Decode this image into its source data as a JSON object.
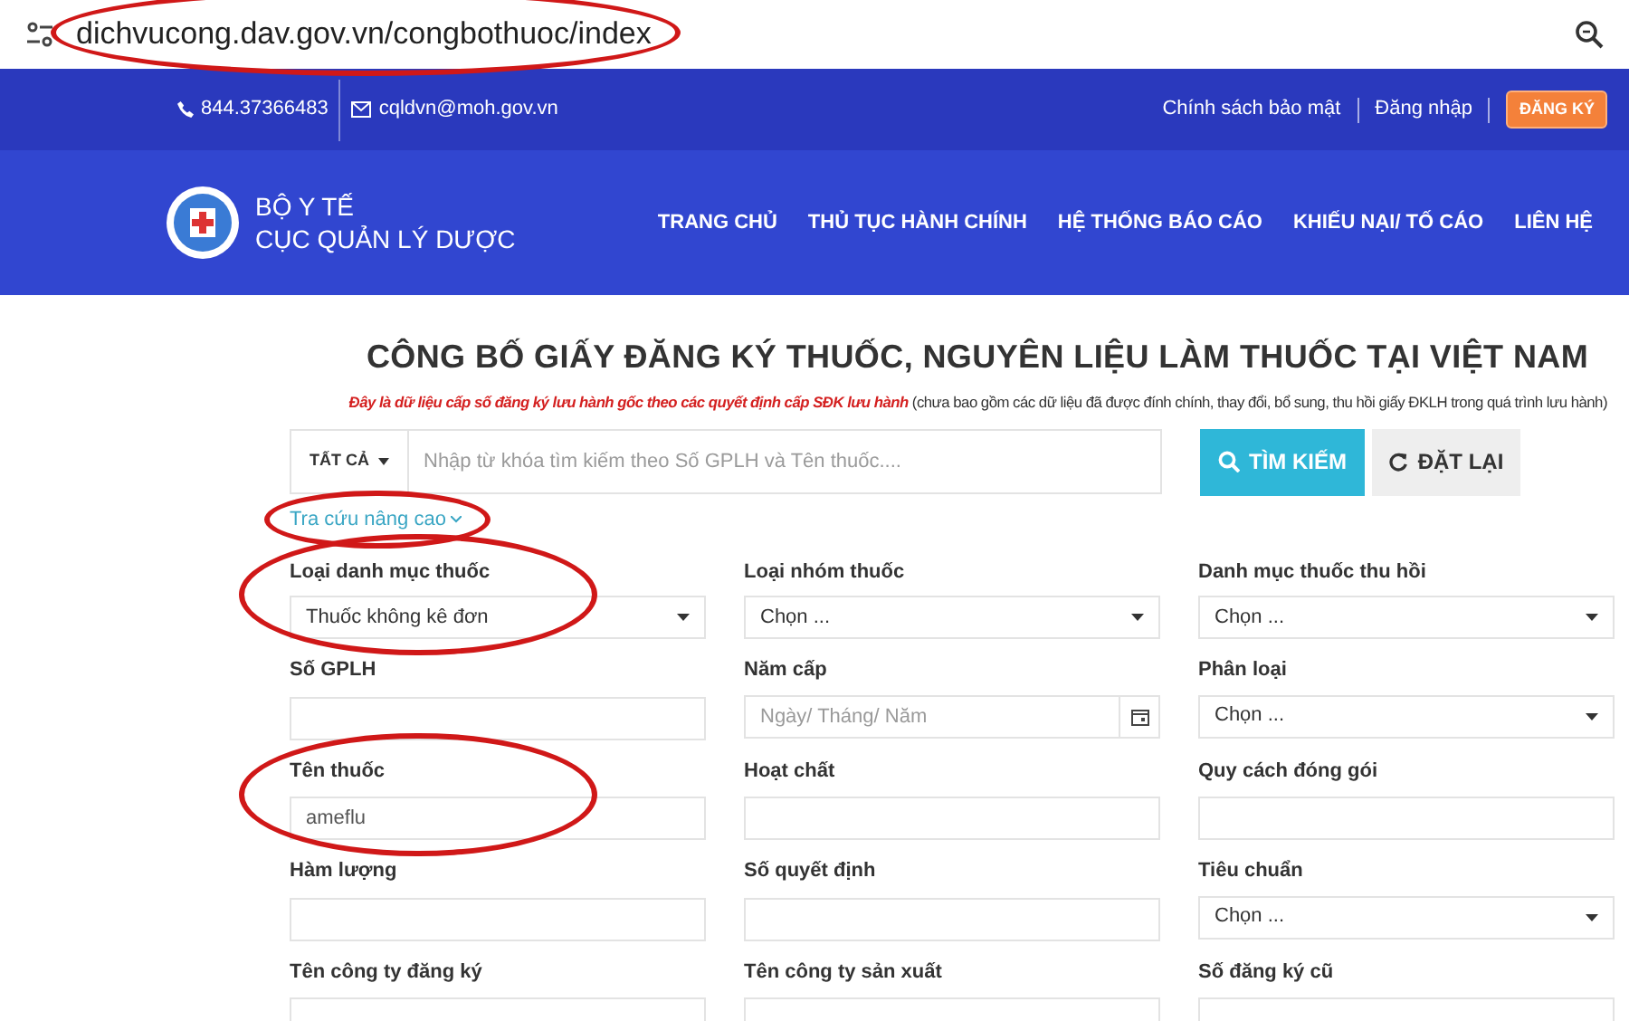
{
  "address_bar": {
    "url": "dichvucong.dav.gov.vn/congbothuoc/index",
    "highlighted": true
  },
  "top_bar": {
    "phone": "844.37366483",
    "email": "cqldvn@moh.gov.vn",
    "links": [
      "Chính sách bảo mật",
      "Đăng nhập"
    ],
    "register_button": "ĐĂNG KÝ"
  },
  "header": {
    "logo_line_1": "BỘ Y TẾ",
    "logo_line_2": "CỤC QUẢN LÝ DƯỢC",
    "nav": [
      "TRANG CHỦ",
      "THỦ TỤC HÀNH CHÍNH",
      "HỆ THỐNG BÁO CÁO",
      "KHIẾU NẠI/ TỐ CÁO",
      "LIÊN HỆ"
    ]
  },
  "page_title": "CÔNG BỐ GIẤY ĐĂNG KÝ THUỐC, NGUYÊN LIỆU LÀM THUỐC TẠI VIỆT NAM",
  "notice": {
    "emphasis": "Đây là dữ liệu cấp số đăng ký lưu hành gốc theo các quyết định cấp SĐK lưu hành",
    "rest": "(chưa bao gồm các dữ liệu đã được đính chính, thay đổi, bổ sung, thu hồi giấy ĐKLH trong quá trình lưu hành)"
  },
  "search": {
    "scope": "TẤT CẢ",
    "placeholder": "Nhập từ khóa tìm kiếm theo Số GPLH và Tên thuốc....",
    "search_button": "TÌM KIẾM",
    "reset_button": "ĐẶT LẠI"
  },
  "advanced_link": {
    "label": "Tra cứu nâng cao",
    "highlighted": true
  },
  "fields": [
    {
      "label": "Loại danh mục thuốc",
      "kind": "select",
      "value": "Thuốc không kê đơn",
      "highlighted": true
    },
    {
      "label": "Loại nhóm thuốc",
      "kind": "select",
      "value": "Chọn ...",
      "highlighted": false
    },
    {
      "label": "Danh mục thuốc thu hồi",
      "kind": "select",
      "value": "Chọn ...",
      "highlighted": false
    },
    {
      "label": "Số GPLH",
      "kind": "text",
      "highlighted": false
    },
    {
      "label": "Năm cấp",
      "kind": "date",
      "placeholder": "Ngày/ Tháng/ Năm",
      "highlighted": false
    },
    {
      "label": "Phân loại",
      "kind": "select",
      "value": "Chọn ...",
      "highlighted": false
    },
    {
      "label": "Tên thuốc",
      "kind": "text",
      "value": "ameflu",
      "highlighted": true
    },
    {
      "label": "Hoạt chất",
      "kind": "text",
      "highlighted": false
    },
    {
      "label": "Quy cách đóng gói",
      "kind": "text",
      "highlighted": false
    },
    {
      "label": "Hàm lượng",
      "kind": "text",
      "highlighted": false
    },
    {
      "label": "Số quyết định",
      "kind": "text",
      "highlighted": false
    },
    {
      "label": "Tiêu chuẩn",
      "kind": "select",
      "value": "Chọn ...",
      "highlighted": false
    },
    {
      "label": "Tên công ty đăng ký",
      "kind": "text",
      "highlighted": false
    },
    {
      "label": "Tên công ty sản xuất",
      "kind": "text",
      "highlighted": false
    },
    {
      "label": "Số đăng ký cũ",
      "kind": "text",
      "highlighted": false
    }
  ]
}
